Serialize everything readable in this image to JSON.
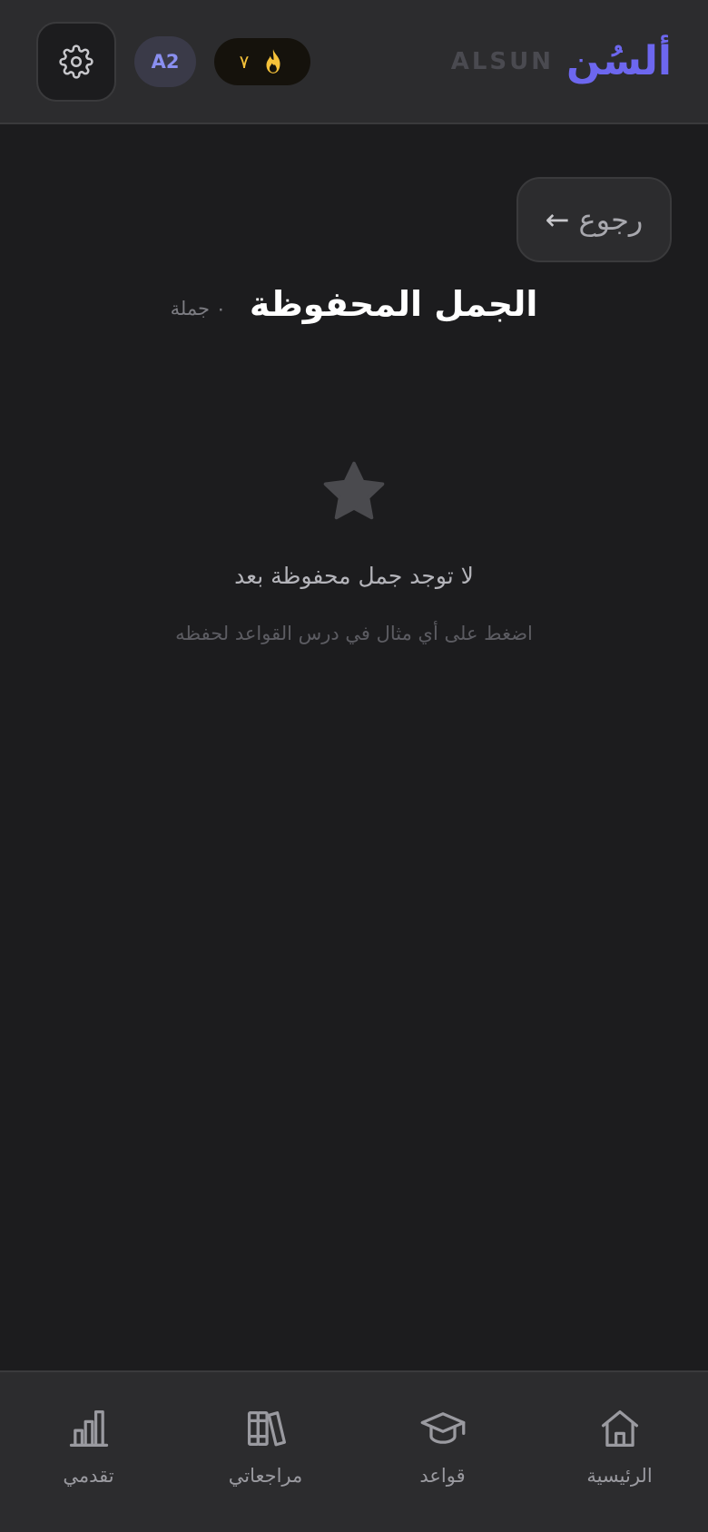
{
  "header": {
    "brand_arabic": "ألسُن",
    "brand_latin": "ALSUN",
    "level": "A2",
    "streak_count": "٧",
    "settings_icon": "gear-icon",
    "streak_icon": "flame-icon",
    "colors": {
      "accent": "#6d67ef",
      "level_text": "#8a8ff0",
      "streak": "#f6c23a"
    }
  },
  "back_button": {
    "label": "رجوع",
    "arrow": "←"
  },
  "page": {
    "title": "الجمل المحفوظة",
    "count": "٠ جملة"
  },
  "empty_state": {
    "icon": "star-icon",
    "title": "لا توجد جمل محفوظة بعد",
    "hint": "اضغط على أي مثال في درس القواعد لحفظه"
  },
  "nav": {
    "items": [
      {
        "label": "الرئيسية",
        "icon": "home-icon"
      },
      {
        "label": "قواعد",
        "icon": "graduation-cap-icon"
      },
      {
        "label": "مراجعاتي",
        "icon": "books-icon"
      },
      {
        "label": "تقدمي",
        "icon": "bar-chart-icon"
      }
    ]
  }
}
